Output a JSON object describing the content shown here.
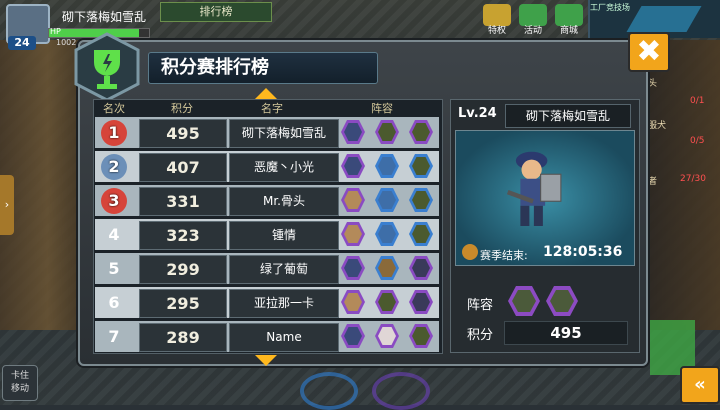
{
  "player": {
    "name": "砌下落梅如雪乱",
    "level": "24",
    "hp_label": "HP",
    "hp_value": "1002",
    "hp_fraction": 0.9
  },
  "top_tab": "排行榜",
  "top_buttons": [
    {
      "label": "特权",
      "icon": "vip-icon"
    },
    {
      "label": "活动",
      "icon": "gift-icon"
    },
    {
      "label": "商城",
      "icon": "cart-icon"
    }
  ],
  "minimap_title": "工厂竞技场",
  "side_texts": [
    "头",
    "0/1",
    "服犬",
    "0/5",
    "者",
    "27/30"
  ],
  "panel": {
    "title": "积分赛排行榜"
  },
  "table": {
    "headers": {
      "rank": "名次",
      "score": "积分",
      "name": "名字",
      "team": "阵容"
    },
    "rows": [
      {
        "rank": "1",
        "score": "495",
        "name": "砌下落梅如雪乱",
        "team": [
          "police",
          "purple-frog",
          "purple-frog"
        ]
      },
      {
        "rank": "2",
        "score": "407",
        "name": "恶魔丶小光",
        "team": [
          "police",
          "blue-girl",
          "blue-frog"
        ]
      },
      {
        "rank": "3",
        "score": "331",
        "name": "Mr.骨头",
        "team": [
          "bald",
          "blue-girl",
          "blue-frog"
        ]
      },
      {
        "rank": "4",
        "score": "323",
        "name": "锺情",
        "team": [
          "bald",
          "blue-girl",
          "blue-frog"
        ]
      },
      {
        "rank": "5",
        "score": "299",
        "name": "绿了葡萄",
        "team": [
          "police",
          "blue-cowboy",
          "purple-girl"
        ]
      },
      {
        "rank": "6",
        "score": "295",
        "name": "亚拉那一卡",
        "team": [
          "bald",
          "purple-frog",
          "purple-girl"
        ]
      },
      {
        "rank": "7",
        "score": "289",
        "name": "Name",
        "team": [
          "police",
          "purple-chef",
          "purple-frog"
        ]
      }
    ]
  },
  "detail": {
    "level": "Lv.24",
    "name": "砌下落梅如雪乱",
    "season_label": "赛季结束:",
    "season_time": "128:05:36",
    "team_label": "阵容",
    "score_label": "积分",
    "score": "495"
  },
  "buttons": {
    "close": "✖",
    "lock": "卡住\n移动",
    "collapse": "«"
  }
}
